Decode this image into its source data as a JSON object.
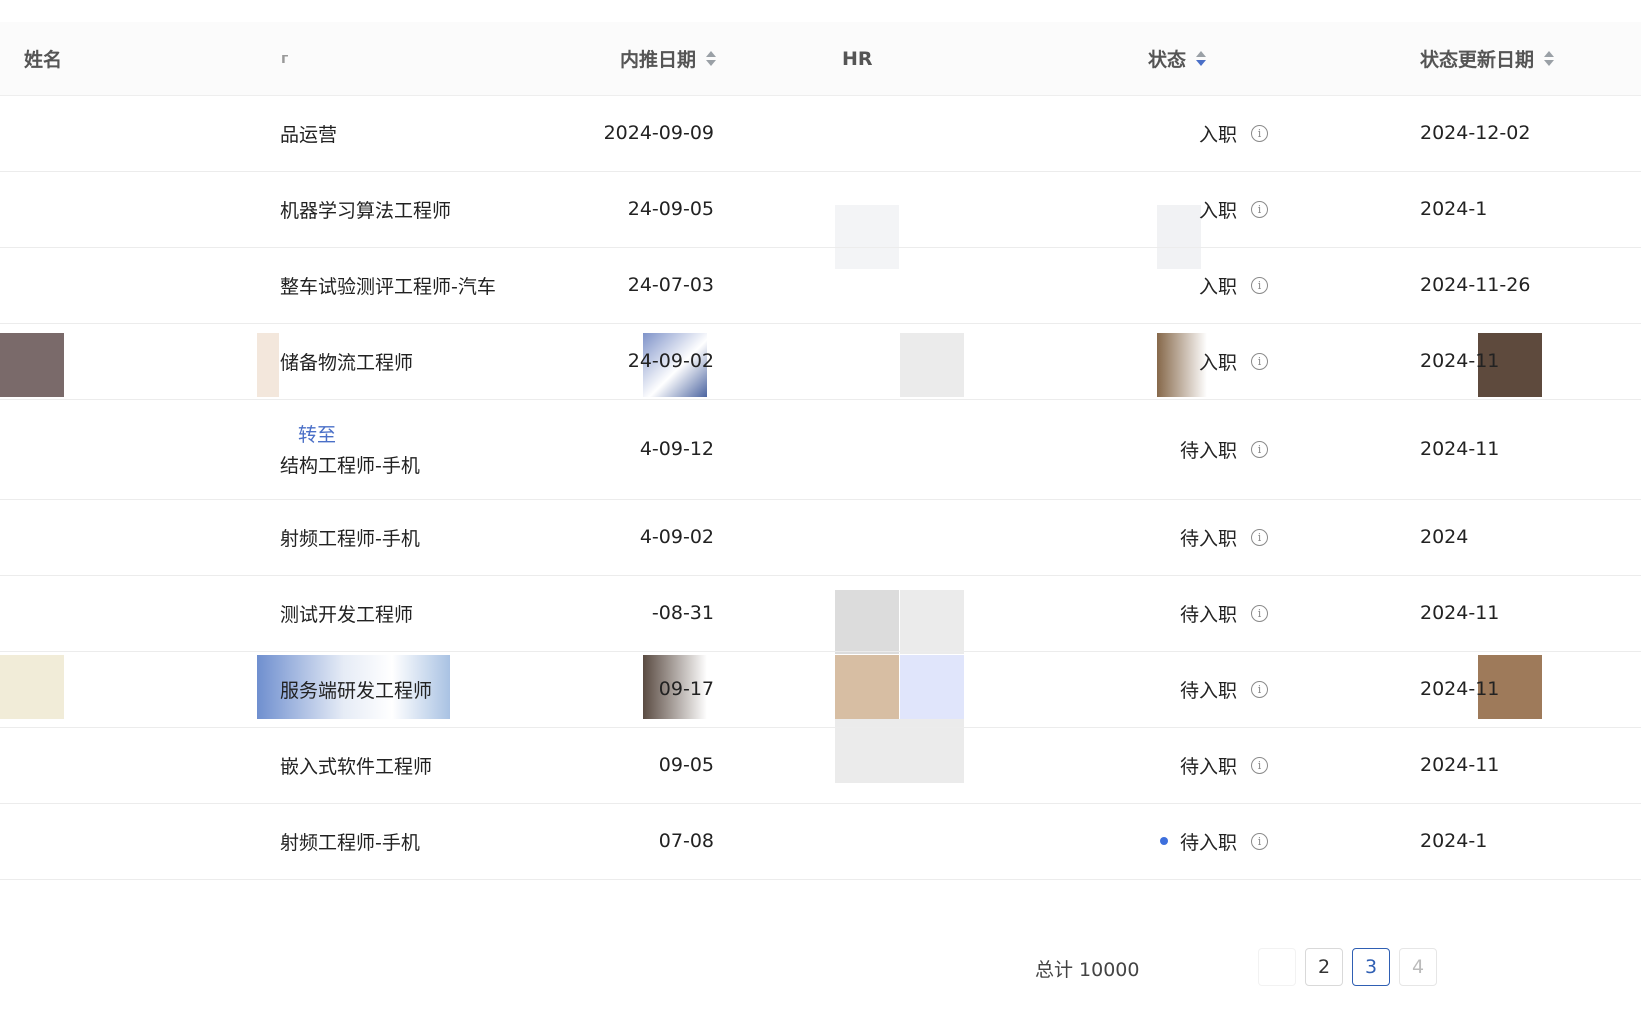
{
  "table": {
    "headers": {
      "name": "姓名",
      "position": "г",
      "referral_date": "内推日期",
      "hr": "HR",
      "status": "状态",
      "status_update_date": "状态更新日期"
    },
    "rows": [
      {
        "position": "品运营",
        "referral_date": "2024-09-09",
        "status": "入职",
        "status_date": "2024-12-02"
      },
      {
        "position": "机器学习算法工程师",
        "referral_date": "24-09-05",
        "status": "入职",
        "status_date": "2024-1"
      },
      {
        "position": "整车试验测评工程师-汽车",
        "referral_date": "24-07-03",
        "status": "入职",
        "status_date": "2024-11-26"
      },
      {
        "position": "储备物流工程师",
        "referral_date": "24-09-02",
        "status": "入职",
        "status_date": "2024-11"
      },
      {
        "position_note": "转至",
        "position": "结构工程师-手机",
        "referral_date": "4-09-12",
        "status": "待入职",
        "status_date": "2024-11"
      },
      {
        "position": "射频工程师-手机",
        "referral_date": "4-09-02",
        "status": "待入职",
        "status_date": "2024"
      },
      {
        "position": "测试开发工程师",
        "referral_date": "-08-31",
        "status": "待入职",
        "status_date": "2024-11"
      },
      {
        "position": "服务端研发工程师",
        "referral_date": "09-17",
        "status": "待入职",
        "status_date": "2024-11"
      },
      {
        "position": "嵌入式软件工程师",
        "referral_date": "09-05",
        "status": "待入职",
        "status_date": "2024-11"
      },
      {
        "position": "射频工程师-手机",
        "referral_date": "07-08",
        "status": "待入职",
        "status_date": "2024-1"
      }
    ]
  },
  "pagination": {
    "total_label": "总计 10000",
    "pages": [
      "2",
      "3",
      "4"
    ],
    "current_page": "3"
  },
  "colors": {
    "accent": "#2f5fb3",
    "link": "#4a6fc7",
    "dot": "#3d6fdc"
  },
  "icons": [
    "info-icon",
    "sort-icon",
    "status-dot-icon"
  ]
}
